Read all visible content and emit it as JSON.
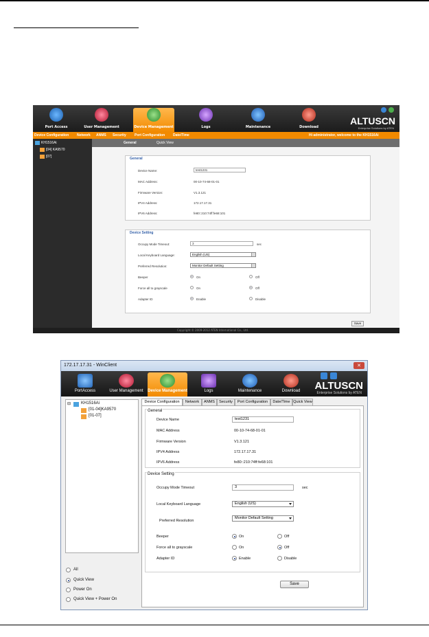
{
  "web": {
    "tabs": [
      "Port Access",
      "User Management",
      "Device Management",
      "Logs",
      "Maintenance",
      "Download"
    ],
    "logo": "ALTUSCN",
    "logo_sub": "Enterprise Solutions by ATEN",
    "subnav": [
      "Device Configuration",
      "Network",
      "ANMS",
      "Security",
      "Port Configuration",
      "Date/Time"
    ],
    "welcome": "Hi administrator, welcome to the KH1516Ai",
    "tree": [
      "KH1516Ai",
      "[04] KA9570",
      "[07]"
    ],
    "content_tabs": [
      "General",
      "Quick View"
    ],
    "general": {
      "heading": "General",
      "device_name_label": "Device Name:",
      "device_name": "test1231",
      "mac_label": "MAC Address:",
      "mac": "00-10-74-68-01-01",
      "fw_label": "Firmware Version:",
      "fw": "V1.3.121",
      "ipv4_label": "IPV4 Address:",
      "ipv4": "172.17.17.31",
      "ipv6_label": "IPV6 Address:",
      "ipv6": "fe80::210:74ff:fe68:101"
    },
    "setting": {
      "heading": "Device Setting",
      "occupy_label": "Occupy Mode Timeout:",
      "occupy": "3",
      "sec": "sec",
      "kbd_label": "Local Keyboard Language:",
      "kbd": "English (US)",
      "res_label": "Preferred Resolution:",
      "res": "Monitor Default Setting",
      "beeper_label": "Beeper",
      "gray_label": "Force all to grayscale",
      "adapter_label": "Adapter ID",
      "on": "On",
      "off": "Off",
      "enable": "Enable",
      "disable": "Disable"
    },
    "save": "Save",
    "footer": "Copyright © 2009-2012 ATEN International Co., Ltd."
  },
  "win": {
    "title": "172.17.17.31 - WinClient",
    "close": "✕",
    "tabs": [
      "PortAccess",
      "User Management",
      "Device Management",
      "Logs",
      "Maintenance",
      "Download"
    ],
    "logo": "ALTUSCN",
    "logo_sub": "Enterprise Solutions by ATEN",
    "tree": [
      "KH1516Ai",
      "[01-04]KA9570",
      "[01-07]"
    ],
    "radios": [
      "All",
      "Quick View",
      "Power On",
      "Quick View + Power On"
    ],
    "config_tabs": [
      "Device Configuration",
      "Network",
      "ANMS",
      "Security",
      "Port Configuration",
      "Date/Time",
      "Quick View"
    ],
    "general": {
      "heading": "General",
      "device_name_label": "Device Name",
      "device_name": "test1231",
      "mac_label": "MAC Address",
      "mac": "00-10-74-68-01-01",
      "fw_label": "Firmware Version",
      "fw": "V1.3.121",
      "ipv4_label": "IPV4 Address",
      "ipv4": "172.17.17.31",
      "ipv6_label": "IPV6 Address",
      "ipv6": "fe80::210:74ff:fe68:101"
    },
    "setting": {
      "heading": "Device Setting",
      "occupy_label": "Occupy Mode Timeout",
      "occupy": "3",
      "sec": "sec",
      "kbd_label": "Local Keyboard Language",
      "kbd": "English (US)",
      "res_label": "Preferred Resolution",
      "res": "Monitor Default Setting",
      "beeper_label": "Beeper",
      "gray_label": "Force all to grayscale",
      "adapter_label": "Adapter ID",
      "on": "On",
      "off": "Off",
      "enable": "Enable",
      "disable": "Disable"
    },
    "save": "Save"
  },
  "colors": {
    "accent": "#f28a00",
    "tab_icon_blue": "#2b7fd1",
    "tab_icon_red": "#c0243b"
  }
}
